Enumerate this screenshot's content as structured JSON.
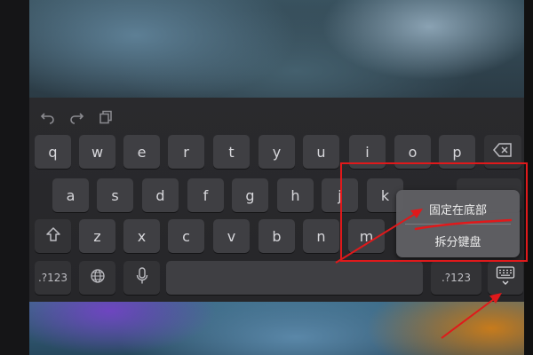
{
  "toolbar": {
    "undo_icon": "undo-icon",
    "redo_icon": "redo-icon",
    "paste_icon": "paste-icon"
  },
  "keyboard": {
    "row1": [
      "q",
      "w",
      "e",
      "r",
      "t",
      "y",
      "u",
      "i",
      "o",
      "p"
    ],
    "row2": [
      "a",
      "s",
      "d",
      "f",
      "g",
      "h",
      "j",
      "k"
    ],
    "row3": [
      "z",
      "x",
      "c",
      "v",
      "b",
      "n",
      "m"
    ],
    "numbers_left": ".?123",
    "numbers_right": ".?123"
  },
  "popup": {
    "dock_label": "固定在底部",
    "split_label": "拆分键盘"
  },
  "annotation": {
    "color": "#e0191b"
  }
}
